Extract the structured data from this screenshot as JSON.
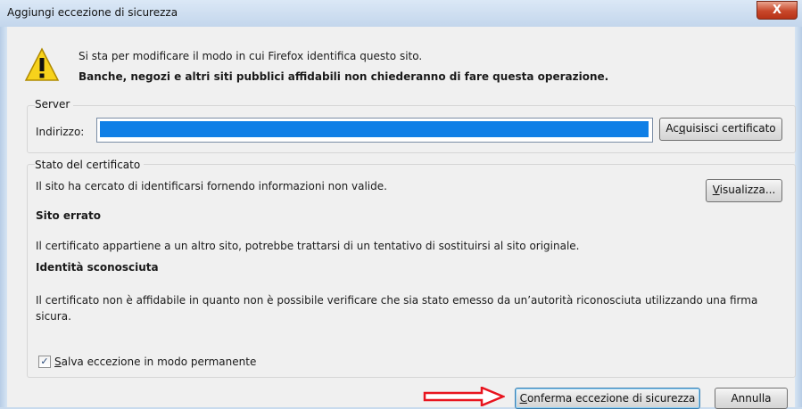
{
  "window": {
    "title": "Aggiungi eccezione di sicurezza",
    "close_label": "X"
  },
  "header": {
    "line1": "Si sta per modificare il modo in cui Firefox identifica questo sito.",
    "line2": "Banche, negozi e altri siti pubblici affidabili non chiederanno di fare questa operazione."
  },
  "server": {
    "group_label": "Server",
    "address_label": "Indirizzo:",
    "address_value": "",
    "get_cert_pre": "Ac",
    "get_cert_key": "q",
    "get_cert_post": "uisisci certificato"
  },
  "status": {
    "group_label": "Stato del certificato",
    "intro": "Il sito ha cercato di identificarsi fornendo informazioni non valide.",
    "view_key": "V",
    "view_post": "isualizza...",
    "wrong_site_title": "Sito errato",
    "wrong_site_text": "Il certificato appartiene a un altro sito, potrebbe trattarsi di un tentativo di sostituirsi al sito originale.",
    "unknown_title": "Identità sconosciuta",
    "unknown_text_1": "Il certificato non è affidabile in quanto non è possibile verificare che sia stato emesso da un’autorità riconosciuta utilizzando una firma",
    "unknown_text_2": "sicura."
  },
  "permanent": {
    "checked": true,
    "check_mark": "✓",
    "label_key": "S",
    "label_post": "alva eccezione in modo permanente"
  },
  "footer": {
    "confirm_key": "C",
    "confirm_post": "onferma eccezione di sicurezza",
    "cancel_label": "Annulla"
  },
  "colors": {
    "selection": "#0f7fe6",
    "arrow": "#e8141e",
    "warning": "#f7d21b"
  },
  "icons": [
    "warning-icon",
    "close-icon",
    "checkbox-checked-icon",
    "red-arrow-icon"
  ]
}
